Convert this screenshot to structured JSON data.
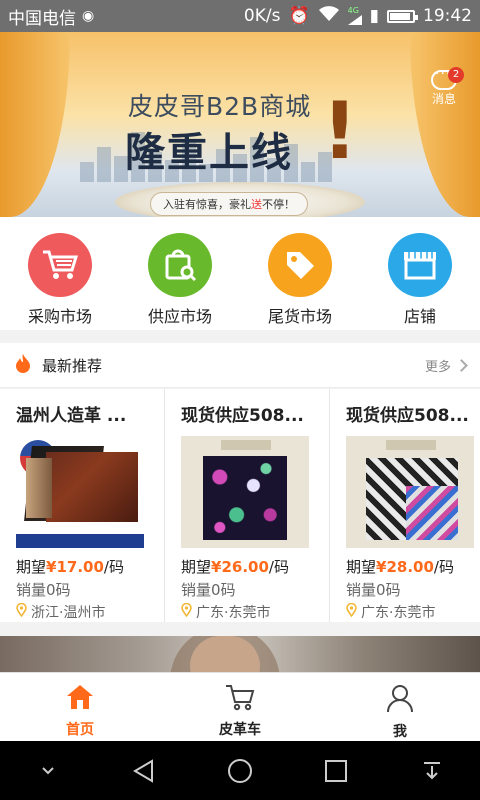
{
  "status_bar": {
    "carrier": "中国电信",
    "speed": "0K/s",
    "network": "4G",
    "time": "19:42",
    "battery_level": 0.9
  },
  "banner": {
    "headline": "皮皮哥B2B商城",
    "subhead": "隆重上线",
    "exclaim": "!",
    "tagline_a": "入驻有惊喜，豪礼",
    "tagline_red": "送",
    "tagline_b": "不停！",
    "slide_count": 3,
    "active_slide": 1
  },
  "messages": {
    "label": "消息",
    "badge_count": "2"
  },
  "quick_nav": [
    {
      "label": "采购市场",
      "icon": "cart-icon",
      "color": "#ef5a5c"
    },
    {
      "label": "供应市场",
      "icon": "supply-bag-icon",
      "color": "#69b92c"
    },
    {
      "label": "尾货市场",
      "icon": "tag-icon",
      "color": "#f8a31d"
    },
    {
      "label": "店铺",
      "icon": "store-icon",
      "color": "#2ba8e7"
    }
  ],
  "recommend": {
    "title": "最新推荐",
    "more_label": "更多",
    "items": [
      {
        "title": "温州人造革 ...",
        "price_prefix": "期望",
        "price": "¥17.00",
        "unit": "/码",
        "sales": "销量0码",
        "location": "浙江·温州市"
      },
      {
        "title": "现货供应508...",
        "price_prefix": "期望",
        "price": "¥26.00",
        "unit": "/码",
        "sales": "销量0码",
        "location": "广东·东莞市"
      },
      {
        "title": "现货供应508...",
        "price_prefix": "期望",
        "price": "¥28.00",
        "unit": "/码",
        "sales": "销量0码",
        "location": "广东·东莞市"
      }
    ]
  },
  "tab_bar": [
    {
      "label": "首页",
      "icon": "home-icon",
      "active": true
    },
    {
      "label": "皮革车",
      "icon": "cart-icon",
      "active": false
    },
    {
      "label": "我",
      "icon": "user-icon",
      "active": false
    }
  ],
  "colors": {
    "accent": "#ff6a1a",
    "badge": "#e43a2b"
  }
}
